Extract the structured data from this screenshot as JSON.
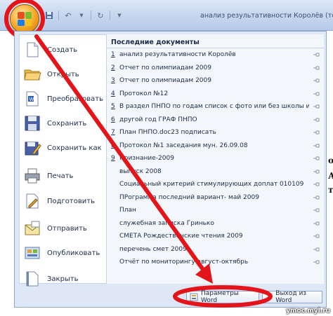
{
  "window": {
    "title": "анализ результативности Королёв (только"
  },
  "recent": {
    "header": "Последние документы",
    "items": [
      {
        "num": "1",
        "name": "анализ результативности Королёв"
      },
      {
        "num": "2",
        "name": "Отчет по олимпиадам 2009"
      },
      {
        "num": "3",
        "name": "Отчет по олимпиадам 2009"
      },
      {
        "num": "4",
        "name": "Протокол №12"
      },
      {
        "num": "5",
        "name": "В раздел ПНПО по годам список с фото или без школы и учи..."
      },
      {
        "num": "6",
        "name": "другой год ГРАФ ПНПО"
      },
      {
        "num": "7",
        "name": "План ПНПО.doc23 подписать"
      },
      {
        "num": "8",
        "name": "Протокол №1 заседания мун. 26.09.08"
      },
      {
        "num": "9",
        "name": "Признание-2009"
      },
      {
        "num": "",
        "name": "выпуск 2008"
      },
      {
        "num": "",
        "name": "Социальный критерий стимулирующих доплат 010109"
      },
      {
        "num": "",
        "name": "ПРограмма последний вариант- май 2009"
      },
      {
        "num": "",
        "name": "План"
      },
      {
        "num": "",
        "name": "служебная записка Гринько"
      },
      {
        "num": "",
        "name": "СМЕТА Рождественские чтения 2009"
      },
      {
        "num": "",
        "name": "перечень смет 2009"
      },
      {
        "num": "",
        "name": "Отчёт по мониторингу август-октябрь"
      }
    ]
  },
  "commands": {
    "create": "Создать",
    "open": "Открыть",
    "convert": "Преобразовать",
    "save": "Сохранить",
    "save_as": "Сохранить как",
    "print": "Печать",
    "prepare": "Подготовить",
    "send": "Отправить",
    "publish": "Опубликовать",
    "close": "Закрыть"
  },
  "bottom": {
    "options": "Параметры Word",
    "exit": "Выход из Word"
  },
  "side_text": [
    "ой",
    "Ав",
    "ту"
  ],
  "watermark": "ymoc.myl.ru",
  "colors": {
    "annotation": "#e3151a",
    "frame": "#dde7f5",
    "office_orange": "#f5a623"
  }
}
